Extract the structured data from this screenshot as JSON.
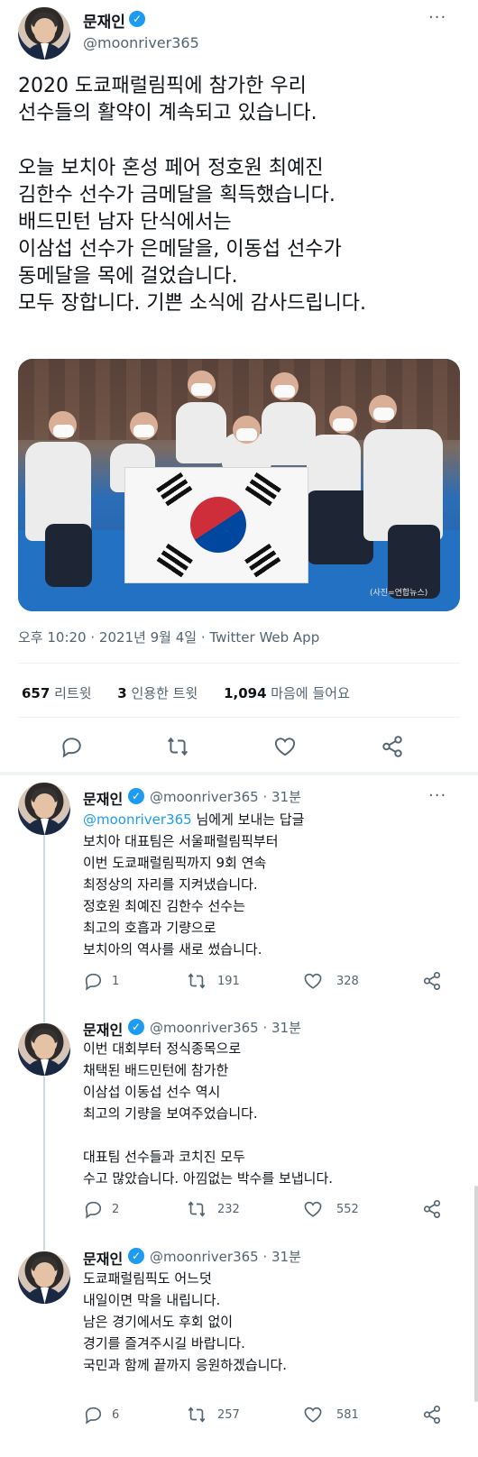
{
  "main_tweet": {
    "author_name": "문재인",
    "author_handle": "@moonriver365",
    "more": "···",
    "text_lines": [
      "2020 도쿄패럴림픽에 참가한 우리",
      "선수들의 활약이 계속되고 있습니다.",
      "",
      "오늘 보치아 혼성 페어 정호원 최예진",
      "김한수 선수가 금메달을 획득했습니다.",
      "배드민턴 남자 단식에서는",
      "이삼섭 선수가 은메달을, 이동섭 선수가",
      "동메달을 목에 걸었습니다.",
      "모두 장합니다. 기쁜 소식에 감사드립니다."
    ],
    "photo_caption": "(사진=연합뉴스)",
    "timestamp": "오후 10:20 · 2021년 9월 4일 · Twitter Web App",
    "stats": {
      "retweets": "657",
      "retweets_label": "리트윗",
      "quotes": "3",
      "quotes_label": "인용한 트윗",
      "likes": "1,094",
      "likes_label": "마음에 들어요"
    }
  },
  "replies": [
    {
      "name": "문재인",
      "handle_time": "@moonriver365 · 31분",
      "reply_to_link": "@moonriver365",
      "reply_to_suffix": " 님에게 보내는 답글",
      "lines": [
        "보치아 대표팀은 서울패럴림픽부터",
        "이번 도쿄패럴림픽까지 9회 연속",
        "최정상의 자리를 지켜냈습니다.",
        "정호원 최예진 김한수 선수는",
        "최고의 호흡과 기량으로",
        "보치아의 역사를 새로 썼습니다."
      ],
      "comments": "1",
      "retweets": "191",
      "likes": "328"
    },
    {
      "name": "문재인",
      "handle_time": "@moonriver365 · 31분",
      "lines": [
        "이번 대회부터 정식종목으로",
        "채택된 배드민턴에 참가한",
        "이삼섭 이동섭 선수 역시",
        "최고의 기량을 보여주었습니다.",
        "",
        "대표팀 선수들과 코치진 모두",
        "수고 많았습니다. 아낌없는 박수를 보냅니다."
      ],
      "comments": "2",
      "retweets": "232",
      "likes": "552"
    },
    {
      "name": "문재인",
      "handle_time": "@moonriver365 · 31분",
      "lines": [
        "도쿄패럴림픽도 어느덧",
        "내일이면 막을 내립니다.",
        "남은 경기에서도 후회 없이",
        "경기를 즐겨주시길 바랍니다.",
        "국민과 함께 끝까지 응원하겠습니다."
      ],
      "comments": "6",
      "retweets": "257",
      "likes": "581"
    }
  ],
  "icons": {
    "verified": "verified-badge-icon",
    "reply": "comment-icon",
    "retweet": "retweet-icon",
    "like": "heart-icon",
    "share": "share-icon"
  },
  "colors": {
    "brand": "#1d9bf0",
    "muted": "#536471",
    "text": "#0f1419"
  }
}
